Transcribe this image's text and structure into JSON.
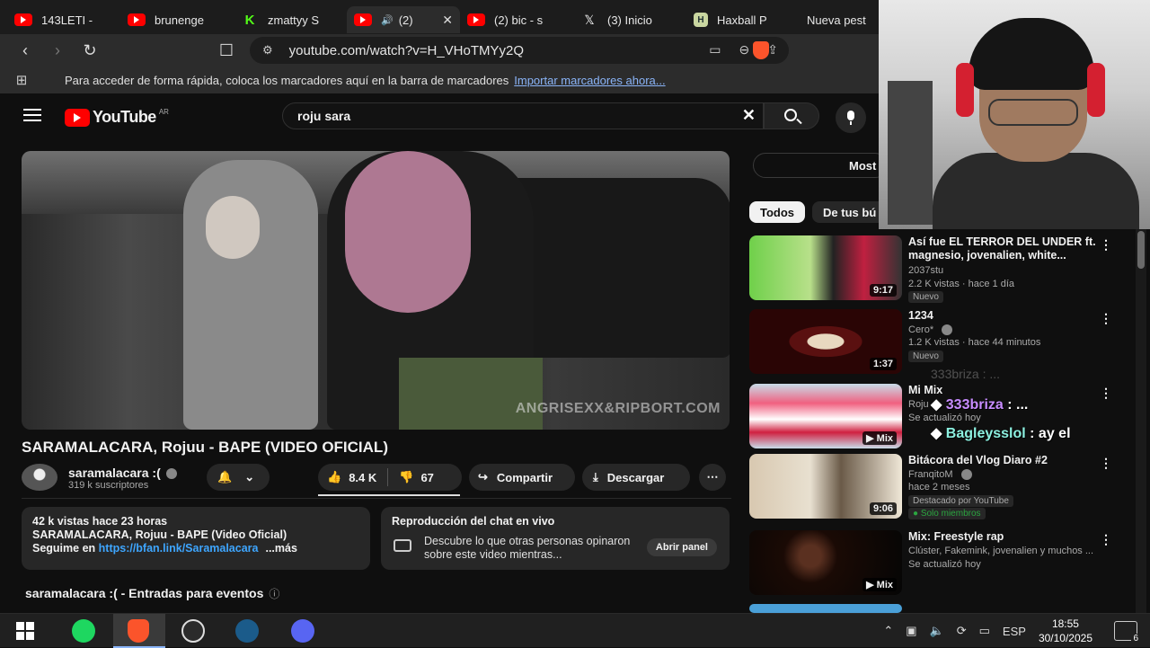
{
  "browser": {
    "tabs": [
      {
        "label": "143LETI -",
        "icon": "youtube-icon"
      },
      {
        "label": "brunenge",
        "icon": "youtube-icon"
      },
      {
        "label": "zmattyy S",
        "icon": "kick-icon"
      },
      {
        "label": "(2)",
        "icon": "youtube-icon"
      },
      {
        "label": "(2) bic - s",
        "icon": "youtube-icon"
      },
      {
        "label": "(3) Inicio",
        "icon": "x-icon"
      },
      {
        "label": "Haxball P",
        "icon": "haxball-icon"
      },
      {
        "label": "Nueva pest",
        "icon": "none"
      }
    ],
    "url": "youtube.com/watch?v=H_VHoTMYy2Q",
    "shields_count": "6",
    "bookmarks_hint": "Para acceder de forma rápida, coloca los marcadores aquí en la barra de marcadores",
    "bookmarks_import": "Importar marcadores ahora..."
  },
  "youtube": {
    "logo": "YouTube",
    "country": "AR",
    "search_query": "roju sara",
    "video": {
      "watermark": "ANGRISEXX&RIPBORT.COM",
      "title": "SARAMALACARA, Rojuu - BAPE (VIDEO OFICIAL)",
      "channel": "saramalacara :(",
      "subscribers": "319 k suscriptores",
      "likes": "8.4 K",
      "dislikes": "67",
      "share": "Compartir",
      "download": "Descargar"
    },
    "description": {
      "meta": "42 k vistas  hace 23 horas",
      "line1": "SARAMALACARA, Rojuu - BAPE (Video Oficial)",
      "line2_prefix": "Seguime en ",
      "link": "https://bfan.link/Saramalacara",
      "more": "...más"
    },
    "chat": {
      "title": "Reproducción del chat en vivo",
      "desc": "Descubre lo que otras personas opinaron sobre este video mientras...",
      "open": "Abrir panel"
    },
    "events": "saramalacara :( - Entradas para eventos",
    "sidebar": {
      "top_label": "Most",
      "chips": [
        "Todos",
        "De tus bú"
      ],
      "recs": [
        {
          "title": "Así fue EL TERROR DEL UNDER ft. magnesio, jovenalien, white...",
          "channel": "2037stu",
          "stats": "2.2 K vistas · hace 1 día",
          "badge": "Nuevo",
          "duration": "9:17"
        },
        {
          "title": "1234",
          "channel": "Cero*",
          "stats": "1.2 K vistas · hace 44 minutos",
          "badge": "Nuevo",
          "duration": "1:37"
        },
        {
          "title": "Mi Mix",
          "channel": "Roju",
          "stats": "Se actualizó hoy",
          "badge": "",
          "duration": "Mix"
        },
        {
          "title": "Bitácora del Vlog Diaro #2",
          "channel": "FranqitoM",
          "stats": "hace 2 meses",
          "badge": "Destacado por YouTube",
          "badge2": "Solo miembros",
          "duration": "9:06"
        },
        {
          "title": "Mix: Freestyle rap",
          "channel": "Clúster, Fakemink, jovenalien y muchos ...",
          "stats": "Se actualizó hoy",
          "badge": "",
          "duration": "Mix"
        }
      ]
    }
  },
  "overlay": {
    "ghost": "333briza : ...",
    "line1_name": "333briza",
    "line1_msg": ": ...",
    "line2_name": "Bagleysslol",
    "line2_msg": ": ay el"
  },
  "taskbar": {
    "lang": "ESP",
    "time": "18:55",
    "date": "30/10/2025",
    "notifications": "6"
  }
}
